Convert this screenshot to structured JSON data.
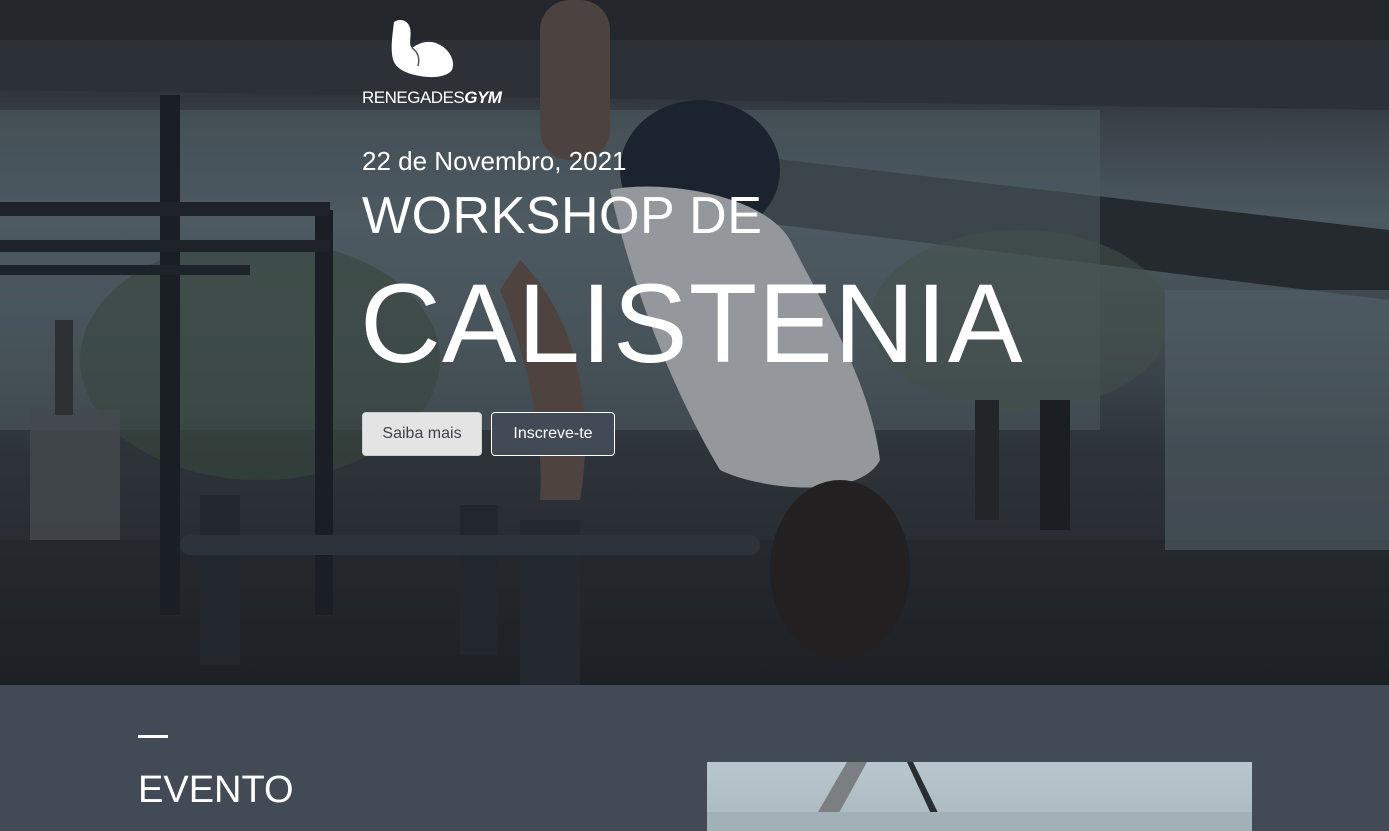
{
  "hero": {
    "logo": {
      "brand_text": "RENEGADES",
      "brand_accent": "GYM"
    },
    "date": "22 de Novembro, 2021",
    "title_line1": "WORKSHOP DE",
    "title_line2": "CALISTENIA",
    "buttons": {
      "more": "Saiba mais",
      "signup": "Inscreve-te"
    }
  },
  "section": {
    "heading": "EVENTO"
  },
  "colors": {
    "section_bg": "#424b55",
    "button_light": "#e4e4e4",
    "text_white": "#ffffff"
  }
}
